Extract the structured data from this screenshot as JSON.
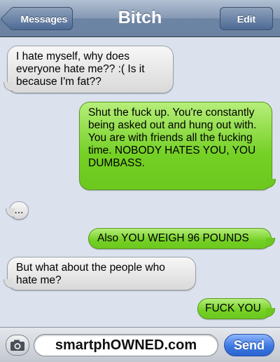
{
  "navbar": {
    "back_label": "Messages",
    "title": "Bitch",
    "edit_label": "Edit"
  },
  "messages": [
    {
      "direction": "incoming",
      "text": "I hate myself, why does everyone hate me?? :( Is it because I'm fat??"
    },
    {
      "direction": "outgoing",
      "text": "Shut the fuck up. You're constantly being asked out and hung out with. You are with friends all the fucking time. NOBODY HATES YOU, YOU DUMBASS."
    },
    {
      "direction": "incoming",
      "text": "..."
    },
    {
      "direction": "outgoing",
      "text": "Also YOU WEIGH 96 POUNDS"
    },
    {
      "direction": "incoming",
      "text": "But what about the people who hate me?"
    },
    {
      "direction": "outgoing",
      "text": "FUCK YOU"
    }
  ],
  "compose": {
    "camera_icon": "camera-icon",
    "input_value": "smartphOWNED.com",
    "send_label": "Send"
  },
  "colors": {
    "outgoing_bubble": "#74d024",
    "incoming_bubble": "#e6e6e6",
    "navbar": "#6d84a3",
    "send_button": "#3d78e0"
  }
}
